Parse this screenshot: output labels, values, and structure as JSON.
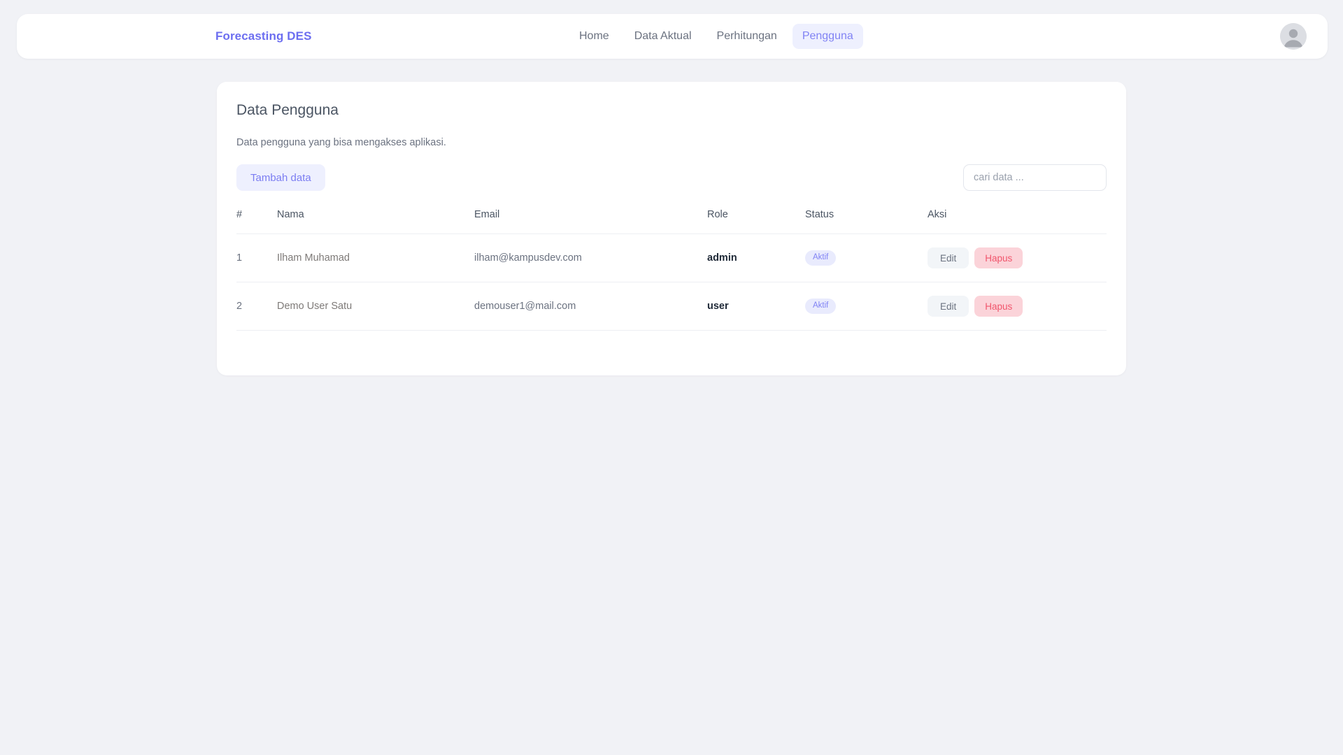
{
  "navbar": {
    "brand": "Forecasting DES",
    "links": [
      {
        "label": "Home",
        "active": false
      },
      {
        "label": "Data Aktual",
        "active": false
      },
      {
        "label": "Perhitungan",
        "active": false
      },
      {
        "label": "Pengguna",
        "active": true
      }
    ],
    "avatar_icon": "user-avatar-placeholder"
  },
  "card": {
    "title": "Data Pengguna",
    "subtitle": "Data pengguna yang bisa mengakses aplikasi.",
    "add_button_label": "Tambah data",
    "search_placeholder": "cari data ...",
    "search_value": ""
  },
  "table": {
    "headers": [
      "#",
      "Nama",
      "Email",
      "Role",
      "Status",
      "Aksi"
    ],
    "rows": [
      {
        "num": "1",
        "nama": "Ilham Muhamad",
        "email": "ilham@kampusdev.com",
        "role": "admin",
        "status": "Aktif",
        "edit_label": "Edit",
        "hapus_label": "Hapus"
      },
      {
        "num": "2",
        "nama": "Demo User Satu",
        "email": "demouser1@mail.com",
        "role": "user",
        "status": "Aktif",
        "edit_label": "Edit",
        "hapus_label": "Hapus"
      }
    ]
  },
  "colors": {
    "brand": "#6c6ef0",
    "accent": "#8183f4",
    "accent_soft_bg": "#eef0fe",
    "danger": "#f1556c",
    "danger_soft_bg": "#fbd3d9",
    "page_bg": "#f1f2f6",
    "card_bg": "#ffffff"
  }
}
